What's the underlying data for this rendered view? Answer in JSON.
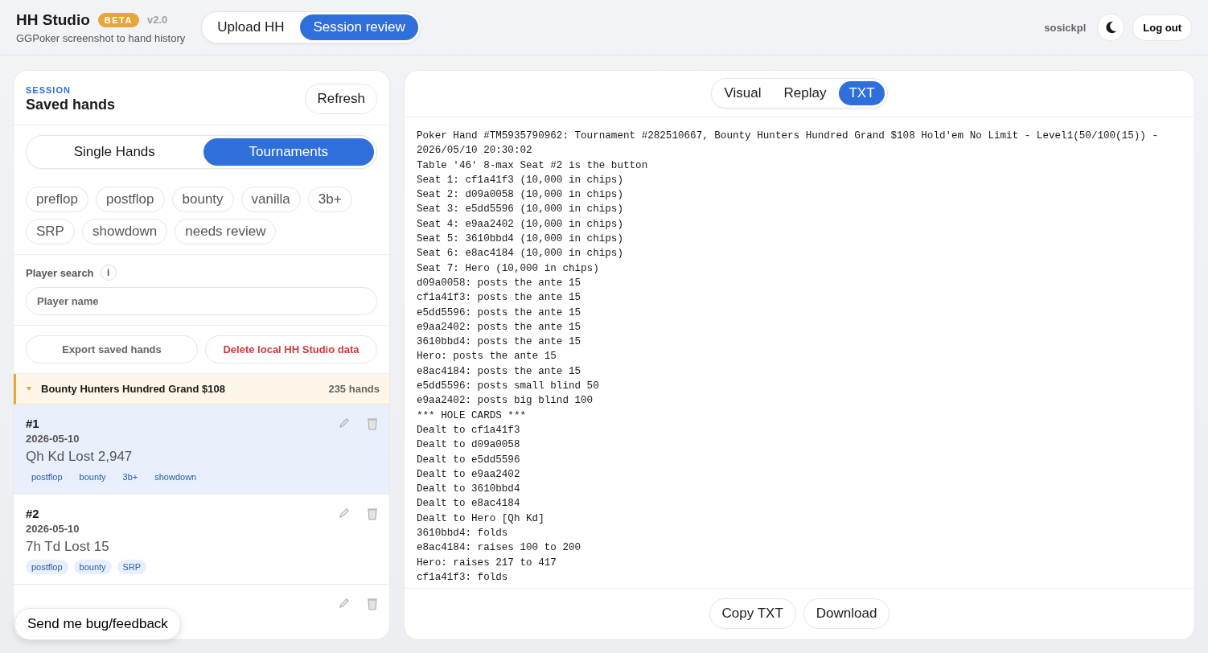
{
  "app": {
    "title": "HH Studio",
    "badge": "BETA",
    "version": "v2.0",
    "subtitle": "GGPoker screenshot to hand history"
  },
  "nav_tabs": [
    {
      "label": "Upload HH",
      "selected": false
    },
    {
      "label": "Session review",
      "selected": true
    }
  ],
  "user": {
    "name": "sosickpl",
    "logout": "Log out"
  },
  "session": {
    "eyebrow": "SESSION",
    "title": "Saved hands",
    "refresh": "Refresh"
  },
  "mode_tabs": [
    {
      "label": "Single Hands",
      "selected": false
    },
    {
      "label": "Tournaments",
      "selected": true
    }
  ],
  "filters": [
    {
      "label": "preflop",
      "selected": false
    },
    {
      "label": "postflop",
      "selected": false
    },
    {
      "label": "bounty",
      "selected": false
    },
    {
      "label": "vanilla",
      "selected": false
    },
    {
      "label": "3b+",
      "selected": false
    },
    {
      "label": "SRP",
      "selected": false
    },
    {
      "label": "showdown",
      "selected": false
    },
    {
      "label": "needs review",
      "selected": false
    }
  ],
  "player_search": {
    "label": "Player search",
    "info": "i",
    "placeholder": "Player name"
  },
  "actions": {
    "export": "Export saved hands",
    "delete": "Delete local HH Studio data"
  },
  "tournament": {
    "name": "Bounty Hunters Hundred Grand $108",
    "count": "235 hands",
    "expanded": true
  },
  "hands": [
    {
      "number": "#1",
      "date": "2026-05-10",
      "summary": "Qh Kd Lost 2,947",
      "tags": [
        "postflop",
        "bounty",
        "3b+",
        "showdown"
      ],
      "selected": true
    },
    {
      "number": "#2",
      "date": "2026-05-10",
      "summary": "7h Td Lost 15",
      "tags": [
        "postflop",
        "bounty",
        "SRP"
      ],
      "selected": false
    },
    {
      "selected": false
    }
  ],
  "feedback": "Send me bug/feedback",
  "view_tabs": [
    {
      "label": "Visual",
      "selected": false
    },
    {
      "label": "Replay",
      "selected": false
    },
    {
      "label": "TXT",
      "selected": true
    }
  ],
  "hand_text": [
    "Poker Hand #TM5935790962: Tournament #282510667, Bounty Hunters Hundred Grand $108 Hold'em No Limit - Level1(50/100(15)) - 2026/05/10 20:30:02",
    "Table '46' 8-max Seat #2 is the button",
    "Seat 1: cf1a41f3 (10,000 in chips)",
    "Seat 2: d09a0058 (10,000 in chips)",
    "Seat 3: e5dd5596 (10,000 in chips)",
    "Seat 4: e9aa2402 (10,000 in chips)",
    "Seat 5: 3610bbd4 (10,000 in chips)",
    "Seat 6: e8ac4184 (10,000 in chips)",
    "Seat 7: Hero (10,000 in chips)",
    "d09a0058: posts the ante 15",
    "cf1a41f3: posts the ante 15",
    "e5dd5596: posts the ante 15",
    "e9aa2402: posts the ante 15",
    "3610bbd4: posts the ante 15",
    "Hero: posts the ante 15",
    "e8ac4184: posts the ante 15",
    "e5dd5596: posts small blind 50",
    "e9aa2402: posts big blind 100",
    "*** HOLE CARDS ***",
    "Dealt to cf1a41f3",
    "Dealt to d09a0058",
    "Dealt to e5dd5596",
    "Dealt to e9aa2402",
    "Dealt to 3610bbd4",
    "Dealt to e8ac4184",
    "Dealt to Hero [Qh Kd]",
    "3610bbd4: folds",
    "e8ac4184: raises 100 to 200",
    "Hero: raises 217 to 417",
    "cf1a41f3: folds"
  ],
  "footer_buttons": [
    "Copy TXT",
    "Download"
  ]
}
